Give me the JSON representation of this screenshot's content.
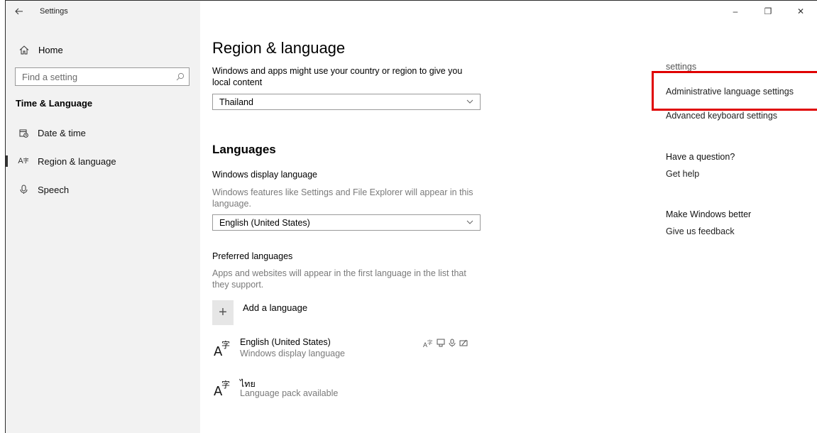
{
  "window": {
    "app_title": "Settings",
    "back_icon": "arrow-left-icon",
    "controls": {
      "minimize": "–",
      "restore": "❐",
      "close": "✕"
    }
  },
  "sidebar": {
    "home_label": "Home",
    "search_placeholder": "Find a setting",
    "section_heading": "Time & Language",
    "items": [
      {
        "label": "Date & time",
        "icon": "calendar-clock-icon"
      },
      {
        "label": "Region & language",
        "icon": "language-icon",
        "active": true
      },
      {
        "label": "Speech",
        "icon": "microphone-icon"
      }
    ]
  },
  "main": {
    "title": "Region & language",
    "region_desc": "Windows and apps might use your country or region to give you local content",
    "region_value": "Thailand",
    "languages_heading": "Languages",
    "display_lang_label": "Windows display language",
    "display_lang_desc": "Windows features like Settings and File Explorer will appear in this language.",
    "display_lang_value": "English (United States)",
    "preferred_label": "Preferred languages",
    "preferred_desc": "Apps and websites will appear in the first language in the list that they support.",
    "add_language_label": "Add a language",
    "languages": [
      {
        "name": "English (United States)",
        "sub": "Windows display language"
      },
      {
        "name": "ไทย",
        "sub": "Language pack available"
      }
    ]
  },
  "right": {
    "cut_link": "settings",
    "admin_link": "Administrative language settings",
    "keyboard_link": "Advanced keyboard settings",
    "question_heading": "Have a question?",
    "help_link": "Get help",
    "better_heading": "Make Windows better",
    "feedback_link": "Give us feedback"
  },
  "colors": {
    "highlight": "#e00000",
    "sidebar_bg": "#f2f2f2"
  }
}
